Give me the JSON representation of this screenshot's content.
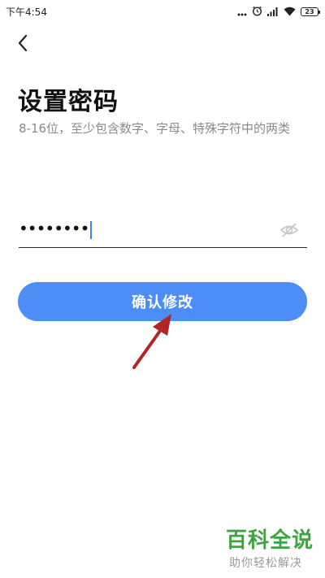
{
  "status_bar": {
    "time": "下午4:54",
    "battery_level": "23",
    "icons": [
      "more-icon",
      "alarm-icon",
      "signal-icon",
      "wifi-icon",
      "battery-icon"
    ]
  },
  "header": {
    "back_icon": "chevron-left-icon"
  },
  "title": "设置密码",
  "subtitle": "8-16位，至少包含数字、字母、特殊字符中的两类",
  "password_field": {
    "value": "••••••••",
    "toggle_icon": "eye-hidden-icon"
  },
  "confirm_button": {
    "label": "确认修改",
    "color": "#4d8ef6"
  },
  "annotation": {
    "arrow_color": "#b32424"
  },
  "watermark": {
    "title": "百科全说",
    "subtitle": "助你轻松解决",
    "color": "#3fa344"
  }
}
